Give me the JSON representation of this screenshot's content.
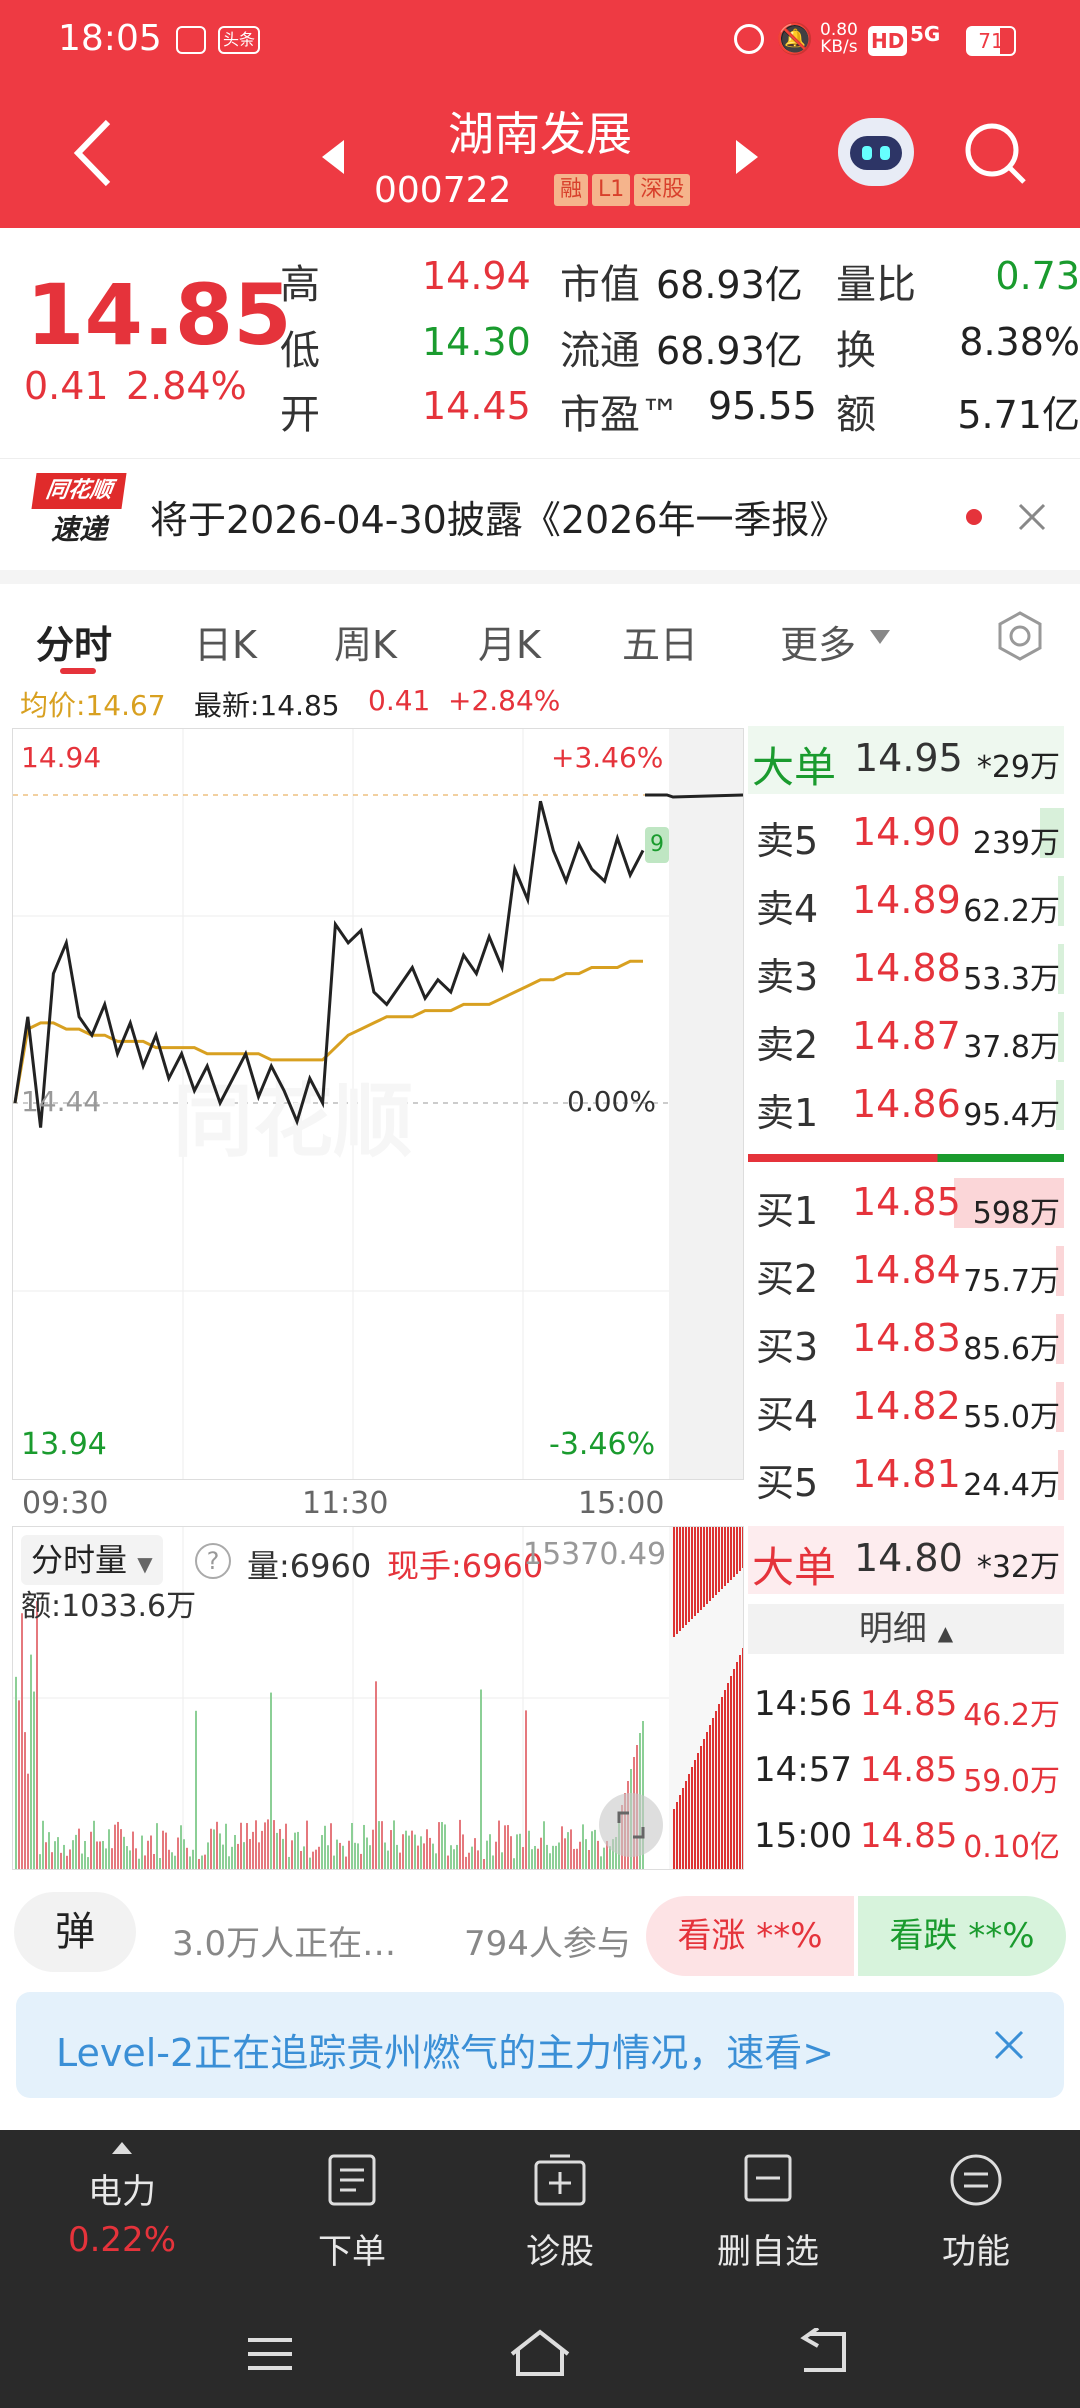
{
  "status": {
    "time": "18:05",
    "net_speed_top": "0.80",
    "net_speed_unit": "KB/s",
    "hd": "HD",
    "network": "5G",
    "battery": "71",
    "notif1": "头条"
  },
  "header": {
    "stock_name": "湖南发展",
    "stock_code": "000722",
    "tags": [
      "融",
      "L1",
      "深股"
    ]
  },
  "quote": {
    "price": "14.85",
    "change": "0.41",
    "change_pct": "2.84%",
    "high_label": "高",
    "high": "14.94",
    "low_label": "低",
    "low": "14.30",
    "open_label": "开",
    "open": "14.45",
    "mcap_label": "市值",
    "mcap": "68.93亿",
    "float_label": "流通",
    "float": "68.93亿",
    "pe_label": "市盈™",
    "pe": "95.55",
    "vr_label": "量比",
    "vr": "0.73",
    "turn_label": "换",
    "turn": "8.38%",
    "amt_label": "额",
    "amt": "5.71亿"
  },
  "notice": {
    "logo_top": "同花顺",
    "logo_bottom": "速递",
    "text": "将于2026-04-30披露《2026年一季报》"
  },
  "tabs": [
    "分时",
    "日K",
    "周K",
    "月K",
    "五日",
    "更多"
  ],
  "chart_info": {
    "avg_label": "均价:14.67",
    "latest_label": "最新:14.85",
    "chg": "0.41",
    "chg_pct": "+2.84%"
  },
  "chart_labels": {
    "top_price": "14.94",
    "top_pct": "+3.46%",
    "mid_price": "14.44",
    "mid_pct": "0.00%",
    "bot_price": "13.94",
    "bot_pct": "-3.46%",
    "t1": "09:30",
    "t2": "11:30",
    "t3": "15:00",
    "watermark": "同花顺",
    "marker": "9"
  },
  "chart_data": {
    "type": "line",
    "x_range": [
      "09:30",
      "15:00"
    ],
    "ylim": [
      13.94,
      14.94
    ],
    "y_ref": 14.44,
    "series": [
      {
        "values": [
          14.44,
          14.58,
          14.4,
          14.65,
          14.7,
          14.58,
          14.55,
          14.6,
          14.52,
          14.57,
          14.5,
          14.55,
          14.48,
          14.52,
          14.46,
          14.5,
          14.44,
          14.48,
          14.52,
          14.45,
          14.5,
          14.46,
          14.41,
          14.48,
          14.44,
          14.73,
          14.7,
          14.72,
          14.62,
          14.6,
          14.63,
          14.66,
          14.61,
          14.64,
          14.62,
          14.68,
          14.65,
          14.71,
          14.66,
          14.82,
          14.77,
          14.93,
          14.85,
          14.8,
          14.86,
          14.82,
          14.8,
          14.87,
          14.81,
          14.85
        ]
      },
      {
        "values": [
          14.44,
          14.56,
          14.57,
          14.57,
          14.56,
          14.56,
          14.55,
          14.55,
          14.54,
          14.54,
          14.54,
          14.53,
          14.53,
          14.53,
          14.53,
          14.52,
          14.52,
          14.52,
          14.52,
          14.52,
          14.51,
          14.51,
          14.51,
          14.51,
          14.51,
          14.53,
          14.55,
          14.56,
          14.57,
          14.58,
          14.58,
          14.58,
          14.59,
          14.59,
          14.59,
          14.6,
          14.6,
          14.6,
          14.61,
          14.62,
          14.63,
          14.64,
          14.64,
          14.65,
          14.65,
          14.66,
          14.66,
          14.66,
          14.67,
          14.67
        ]
      }
    ]
  },
  "orderbook": {
    "big_sell_label": "大单",
    "big_sell_px": "14.95",
    "big_sell_vol": "*29万",
    "asks": [
      {
        "label": "卖5",
        "px": "14.90",
        "vol": "239万",
        "bar": 0.08
      },
      {
        "label": "卖4",
        "px": "14.89",
        "vol": "62.2万",
        "bar": 0.02
      },
      {
        "label": "卖3",
        "px": "14.88",
        "vol": "53.3万",
        "bar": 0.02
      },
      {
        "label": "卖2",
        "px": "14.87",
        "vol": "37.8万",
        "bar": 0.02
      },
      {
        "label": "卖1",
        "px": "14.86",
        "vol": "95.4万",
        "bar": 0.03
      }
    ],
    "bids": [
      {
        "label": "买1",
        "px": "14.85",
        "vol": "598万",
        "bar": 0.21
      },
      {
        "label": "买2",
        "px": "14.84",
        "vol": "75.7万",
        "bar": 0.02
      },
      {
        "label": "买3",
        "px": "14.83",
        "vol": "85.6万",
        "bar": 0.02
      },
      {
        "label": "买4",
        "px": "14.82",
        "vol": "55.0万",
        "bar": 0.02
      },
      {
        "label": "买5",
        "px": "14.81",
        "vol": "24.4万",
        "bar": 0.01
      }
    ],
    "big_buy_label": "大单",
    "big_buy_px": "14.80",
    "big_buy_vol": "*32万"
  },
  "volume": {
    "selector": "分时量",
    "vol": "量:6960",
    "hand": "现手:6960",
    "max": "15370.49",
    "amount": "额:1033.6万"
  },
  "ticks": {
    "header": "明细",
    "rows": [
      {
        "t": "14:56",
        "px": "14.85",
        "v": "46.2万"
      },
      {
        "t": "14:57",
        "px": "14.85",
        "v": "59.0万"
      },
      {
        "t": "15:00",
        "px": "14.85",
        "v": "0.10亿"
      }
    ]
  },
  "social": {
    "danmu": "弹",
    "watching": "3.0万人正在…",
    "participants": "794人参与",
    "up_label": "看涨 **%",
    "down_label": "看跌 **%"
  },
  "promo": {
    "text": "Level-2正在追踪贵州燃气的主力情况，速看>"
  },
  "bottom": {
    "sector": "电力",
    "sector_pct": "0.22%",
    "order": "下单",
    "diagnose": "诊股",
    "remove": "删自选",
    "function": "功能"
  }
}
